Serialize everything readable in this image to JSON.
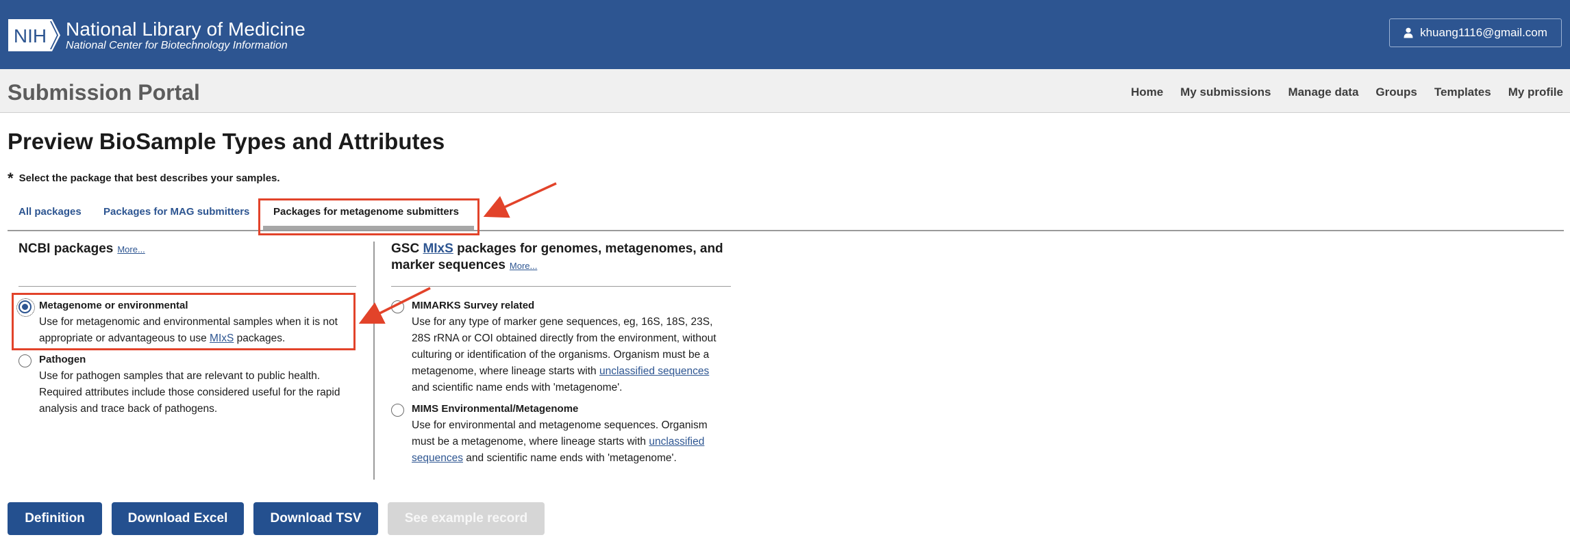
{
  "header": {
    "logo_text": "NIH",
    "org_name": "National Library of Medicine",
    "org_subtitle": "National Center for Biotechnology Information",
    "account_email": "khuang1116@gmail.com"
  },
  "portal": {
    "title": "Submission Portal",
    "nav": [
      "Home",
      "My submissions",
      "Manage data",
      "Groups",
      "Templates",
      "My profile"
    ]
  },
  "page": {
    "title": "Preview BioSample Types and Attributes",
    "required_marker": "*",
    "instruction": "Select the package that best describes your samples."
  },
  "tabs": {
    "all": "All packages",
    "mag": "Packages for MAG submitters",
    "metagenome": "Packages for metagenome submitters",
    "selected": "metagenome"
  },
  "ncbi": {
    "heading": "NCBI packages",
    "more": "More...",
    "options": [
      {
        "title": "Metagenome or environmental",
        "desc_line1": "Use for metagenomic and environmental samples when it is not",
        "desc_line2_pre": "appropriate or advantageous to use ",
        "desc_link": "MIxS",
        "desc_line2_post": " packages.",
        "checked": true
      },
      {
        "title": "Pathogen",
        "desc_line1": "Use for pathogen samples that are relevant to public health.",
        "desc_line2": "Required attributes include those considered useful for the rapid",
        "desc_line3": "analysis and trace back of pathogens.",
        "checked": false
      }
    ]
  },
  "gsc": {
    "heading_pre": "GSC ",
    "heading_link": "MIxS",
    "heading_post": " packages for genomes, metagenomes, and",
    "heading_line2": "marker sequences",
    "more": "More...",
    "options": [
      {
        "title": "MIMARKS Survey related",
        "line1": "Use for any type of marker gene sequences, eg, 16S, 18S, 23S,",
        "line2": "28S rRNA or COI obtained directly from the environment, without",
        "line3": "culturing or identification of the organisms. Organism must be a",
        "line4_pre": "metagenome, where lineage starts with ",
        "line4_link": "unclassified sequences",
        "line5": "and scientific name ends with 'metagenome'.",
        "checked": false
      },
      {
        "title": "MIMS Environmental/Metagenome",
        "line1": "Use for environmental and metagenome sequences. Organism",
        "line2_pre": "must be a metagenome, where lineage starts with ",
        "line2_link": "unclassified",
        "line3_link": "sequences",
        "line3_post": " and scientific name ends with 'metagenome'.",
        "checked": false
      }
    ]
  },
  "buttons": {
    "definition": "Definition",
    "download_excel": "Download Excel",
    "download_tsv": "Download TSV",
    "see_example": "See example record",
    "see_example_disabled": true
  },
  "colors": {
    "header_bg": "#2d5591",
    "button_bg": "#24508f",
    "annotation_red": "#e2432a",
    "disabled_button": "#d6d6d6"
  }
}
